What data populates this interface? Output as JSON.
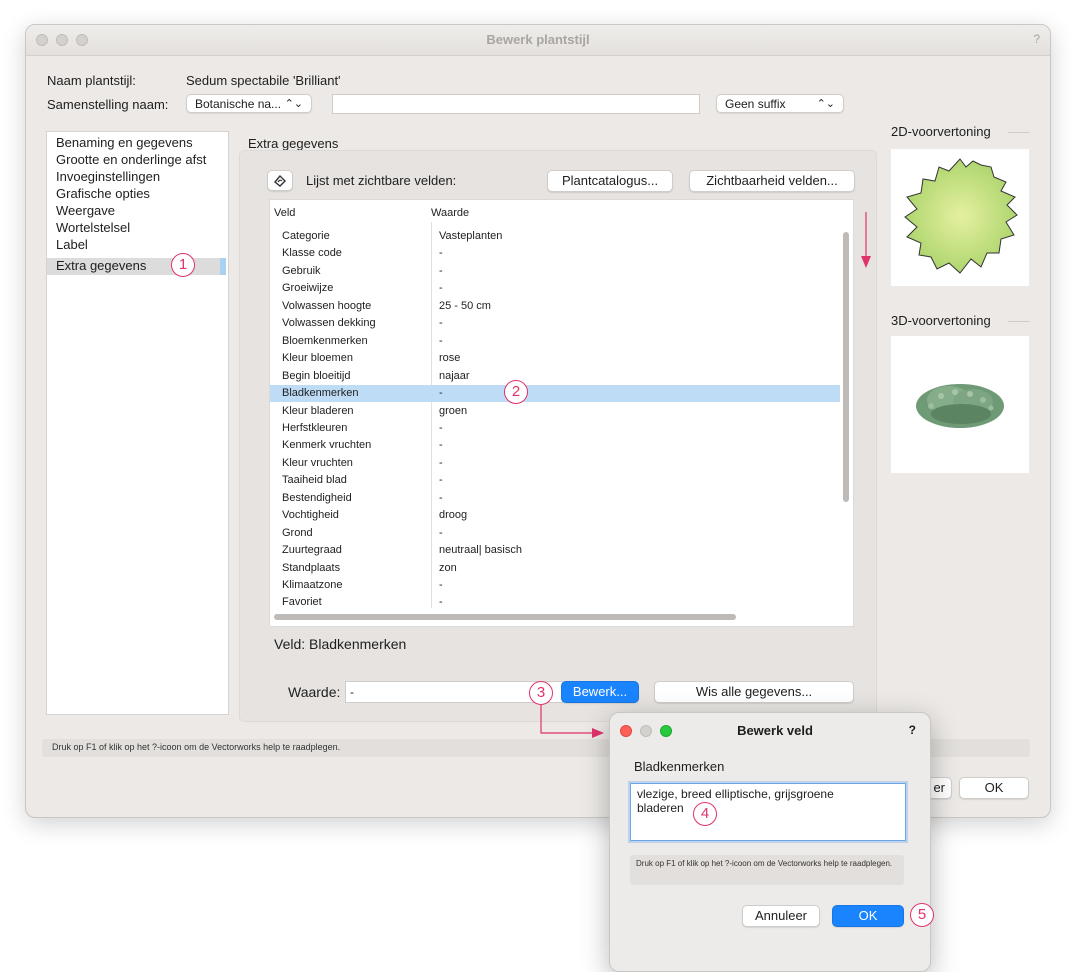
{
  "main_window": {
    "title": "Bewerk plantstijl",
    "help": "?",
    "name_label": "Naam plantstijl:",
    "name_value": "Sedum spectabile 'Brilliant'",
    "composition_label": "Samenstelling naam:",
    "composition_select": "Botanische na...",
    "composition_text": "",
    "suffix_select": "Geen suffix",
    "sidebar_items": [
      "Benaming en gegevens",
      "Grootte en onderlinge afst",
      "Invoeginstellingen",
      "Grafische opties",
      "Weergave",
      "Wortelstelsel",
      "Label",
      "Extra gegevens"
    ],
    "selected_sidebar_index": 7,
    "section_title": "Extra gegevens",
    "visible_fields_label": "Lijst met zichtbare velden:",
    "plant_catalog_button": "Plantcatalogus...",
    "field_visibility_button": "Zichtbaarheid velden...",
    "table": {
      "headers": [
        "Veld",
        "Waarde"
      ],
      "rows": [
        [
          "Categorie",
          "Vasteplanten"
        ],
        [
          "Klasse code",
          "-"
        ],
        [
          "Gebruik",
          "-"
        ],
        [
          "Groeiwijze",
          "-"
        ],
        [
          "Volwassen hoogte",
          "25 - 50 cm"
        ],
        [
          "Volwassen dekking",
          "-"
        ],
        [
          "Bloemkenmerken",
          "-"
        ],
        [
          "Kleur bloemen",
          "rose"
        ],
        [
          "Begin bloeitijd",
          "najaar"
        ],
        [
          "Bladkenmerken",
          "-"
        ],
        [
          "Kleur bladeren",
          "groen"
        ],
        [
          "Herfstkleuren",
          "-"
        ],
        [
          "Kenmerk vruchten",
          "-"
        ],
        [
          "Kleur vruchten",
          "-"
        ],
        [
          "Taaiheid blad",
          "-"
        ],
        [
          "Bestendigheid",
          "-"
        ],
        [
          "Vochtigheid",
          "droog"
        ],
        [
          "Grond",
          "-"
        ],
        [
          "Zuurtegraad",
          "neutraal| basisch"
        ],
        [
          "Standplaats",
          "zon"
        ],
        [
          "Klimaatzone",
          "-"
        ],
        [
          "Favoriet",
          "-"
        ]
      ],
      "selected_row_index": 9
    },
    "field_label": "Veld:  Bladkenmerken",
    "value_label": "Waarde:",
    "value_field": "-",
    "edit_button": "Bewerk...",
    "clear_all_button": "Wis alle gegevens...",
    "help_text": "Druk op F1 of klik op het ?-icoon om de Vectorworks help te raadplegen.",
    "cancel_button_partial": "er",
    "ok_button": "OK",
    "preview_2d_title": "2D-voorvertoning",
    "preview_3d_title": "3D-voorvertoning"
  },
  "edit_dialog": {
    "title": "Bewerk veld",
    "help": "?",
    "field_name": "Bladkenmerken",
    "text_value": "vlezige, breed elliptische, grijsgroene bladeren",
    "help_text": "Druk op F1 of klik op het ?-icoon om de Vectorworks help te raadplegen.",
    "cancel_button": "Annuleer",
    "ok_button": "OK"
  },
  "callouts": [
    "1",
    "2",
    "3",
    "4",
    "5"
  ],
  "colors": {
    "accent": "#1a84ff",
    "callout": "#e0336b",
    "selection": "#bfdcf7",
    "plant_2d_fill": "#c6e07a",
    "plant_3d": "#6f9a76"
  }
}
